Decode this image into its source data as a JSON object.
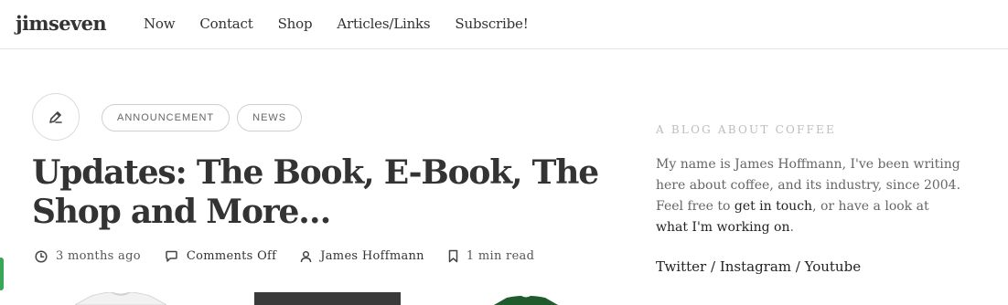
{
  "site": {
    "logo": "jimseven"
  },
  "nav": {
    "items": [
      "Now",
      "Contact",
      "Shop",
      "Articles/Links",
      "Subscribe!"
    ]
  },
  "post": {
    "format_icon": "pencil-icon",
    "tags": [
      "ANNOUNCEMENT",
      "NEWS"
    ],
    "title": "Updates: The Book, E-Book, The Shop and More…",
    "meta": {
      "time": "3 months ago",
      "comments": "Comments Off",
      "author": "James Hoffmann",
      "read_time": "1 min read"
    }
  },
  "sidebar": {
    "heading": "A BLOG ABOUT COFFEE",
    "about_1": "My name is James Hoffmann, I've been writing here about coffee, and its industry, since 2004. Feel free to ",
    "about_link_1": "get in touch",
    "about_2": ", or have a look at ",
    "about_link_2": "what I'm working on",
    "about_3": ".",
    "social": {
      "twitter": "Twitter",
      "instagram": "Instagram",
      "youtube": "Youtube",
      "separator": " / "
    }
  },
  "colors": {
    "accent_tab": "#3aa757",
    "text": "#333333",
    "muted": "#bdbdbd"
  }
}
